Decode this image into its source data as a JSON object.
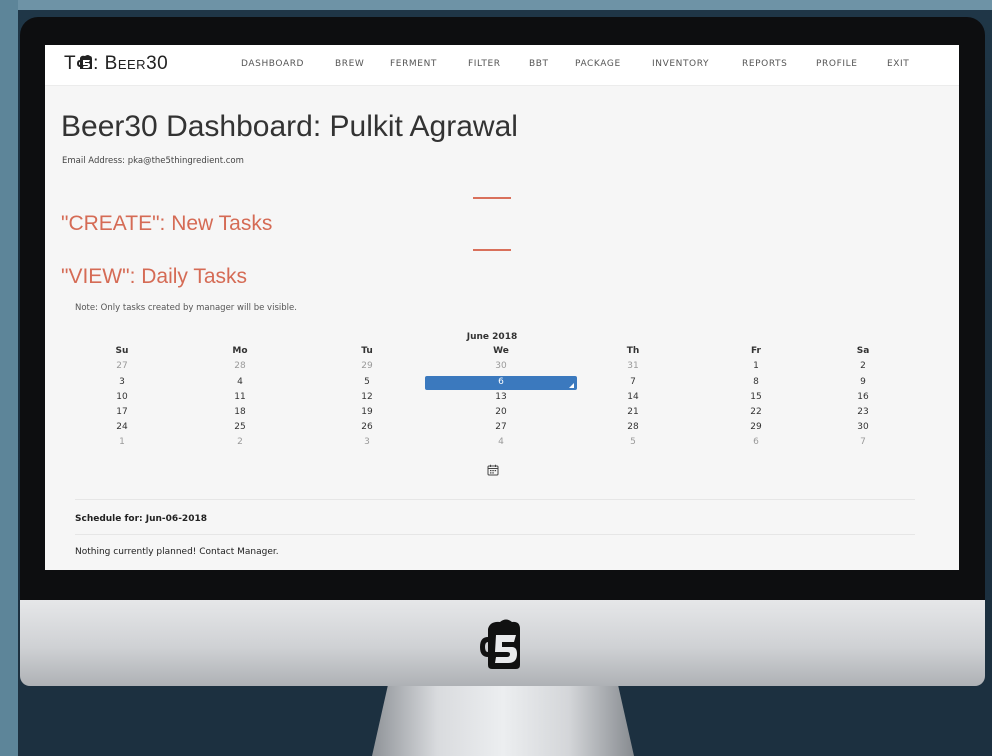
{
  "brand": {
    "prefix": "T",
    "middle": ": ",
    "name": "Beer30"
  },
  "nav": {
    "items": [
      {
        "label": "DASHBOARD"
      },
      {
        "label": "BREW"
      },
      {
        "label": "FERMENT"
      },
      {
        "label": "FILTER"
      },
      {
        "label": "BBT"
      },
      {
        "label": "PACKAGE"
      },
      {
        "label": "INVENTORY"
      },
      {
        "label": "REPORTS"
      },
      {
        "label": "PROFILE"
      },
      {
        "label": "EXIT"
      }
    ]
  },
  "page": {
    "title": "Beer30 Dashboard: Pulkit Agrawal",
    "email": "Email Address: pka@the5thingredient.com"
  },
  "create_section": {
    "heading": "\"CREATE\": New Tasks"
  },
  "view_section": {
    "heading": "\"VIEW\": Daily Tasks",
    "note": "Note: Only tasks created by manager will be visible."
  },
  "calendar": {
    "month_label": "June 2018",
    "weekdays": [
      "Su",
      "Mo",
      "Tu",
      "We",
      "Th",
      "Fr",
      "Sa"
    ],
    "weeks": [
      [
        "27",
        "28",
        "29",
        "30",
        "31",
        "1",
        "2"
      ],
      [
        "3",
        "4",
        "5",
        "6",
        "7",
        "8",
        "9"
      ],
      [
        "10",
        "11",
        "12",
        "13",
        "14",
        "15",
        "16"
      ],
      [
        "17",
        "18",
        "19",
        "20",
        "21",
        "22",
        "23"
      ],
      [
        "24",
        "25",
        "26",
        "27",
        "28",
        "29",
        "30"
      ],
      [
        "1",
        "2",
        "3",
        "4",
        "5",
        "6",
        "7"
      ]
    ],
    "selected_day": "6",
    "icon": "calendar-icon"
  },
  "schedule": {
    "label": "Schedule for: Jun-06-2018",
    "empty_message": "Nothing currently planned! Contact Manager."
  },
  "colors": {
    "accent": "#d56b55",
    "selected": "#3b79be"
  }
}
